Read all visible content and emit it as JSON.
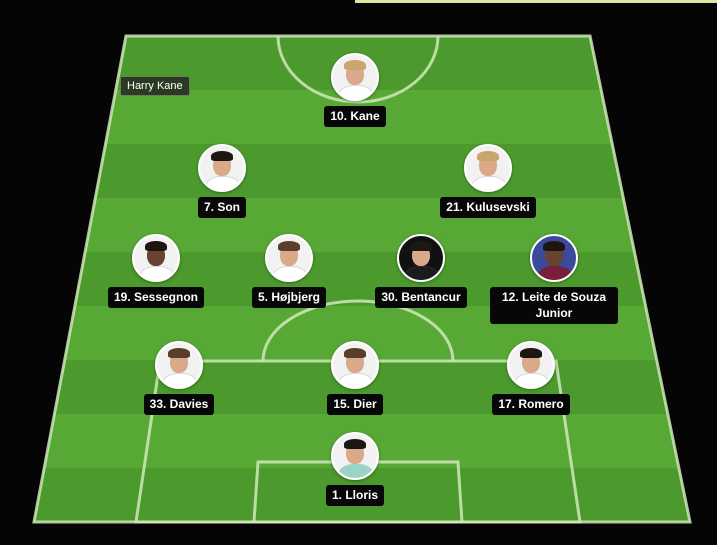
{
  "tooltip": "Harry Kane",
  "colors": {
    "pitch_dark": "#4c9a2d",
    "pitch_light": "#5aaa38",
    "lines": "#cfe8b8",
    "label_bg": "#070707"
  },
  "players": [
    {
      "label": "10. Kane"
    },
    {
      "label": "7. Son"
    },
    {
      "label": "21. Kulusevski"
    },
    {
      "label": "19. Sessegnon"
    },
    {
      "label": "5. Højbjerg"
    },
    {
      "label": "30. Bentancur"
    },
    {
      "label": "12. Leite de Souza Junior"
    },
    {
      "label": "33. Davies"
    },
    {
      "label": "15. Dier"
    },
    {
      "label": "17. Romero"
    },
    {
      "label": "1. Lloris"
    }
  ]
}
